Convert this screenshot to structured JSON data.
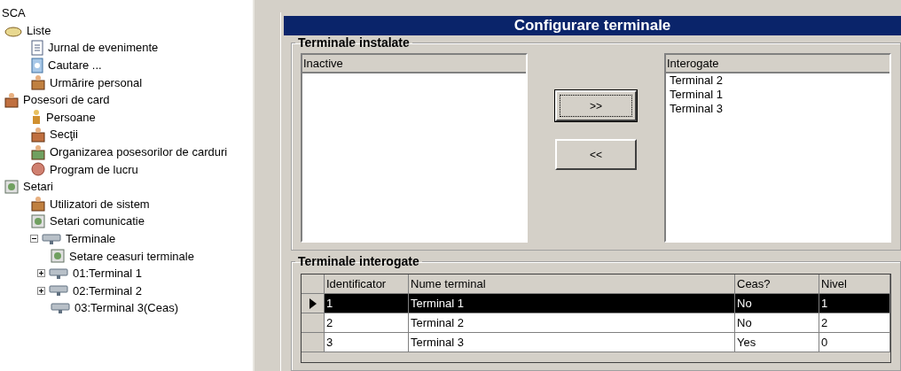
{
  "tree": {
    "root": "SCA",
    "items": [
      {
        "label": "Liste",
        "children": [
          {
            "label": "Jurnal de evenimente"
          },
          {
            "label": "Cautare ..."
          },
          {
            "label": "Urmărire personal"
          }
        ]
      },
      {
        "label": "Posesori de card",
        "children": [
          {
            "label": "Persoane"
          },
          {
            "label": "Secţii"
          },
          {
            "label": "Organizarea posesorilor de carduri"
          },
          {
            "label": "Program de lucru"
          }
        ]
      },
      {
        "label": "Setari",
        "children": [
          {
            "label": "Utilizatori de sistem"
          },
          {
            "label": "Setari comunicatie"
          },
          {
            "label": "Terminale",
            "expanded": true,
            "children": [
              {
                "label": "Setare ceasuri terminale"
              },
              {
                "label": "01:Terminal 1",
                "expanded": false
              },
              {
                "label": "02:Terminal 2",
                "expanded": false
              },
              {
                "label": "03:Terminal 3(Ceas)"
              }
            ]
          }
        ]
      }
    ]
  },
  "panel": {
    "title": "Configurare terminale",
    "installed": {
      "title": "Terminale instalate",
      "inactive": {
        "header": "Inactive"
      },
      "polled": {
        "header": "Interogate",
        "items": [
          "Terminal 2",
          "Terminal 1",
          "Terminal 3"
        ]
      },
      "buttons": [
        {
          "label": ">>",
          "focused": true
        },
        {
          "label": "<<",
          "focused": false
        }
      ]
    },
    "polled_table": {
      "title": "Terminale interogate",
      "columns": [
        "Identificator",
        "Nume terminal",
        "Ceas?",
        "Nivel"
      ],
      "rows": [
        {
          "cells": [
            "1",
            "Terminal 1",
            "No",
            "1"
          ],
          "selected": true
        },
        {
          "cells": [
            "2",
            "Terminal 2",
            "No",
            "2"
          ],
          "selected": false
        },
        {
          "cells": [
            "3",
            "Terminal 3",
            "Yes",
            "0"
          ],
          "selected": false
        }
      ]
    }
  }
}
